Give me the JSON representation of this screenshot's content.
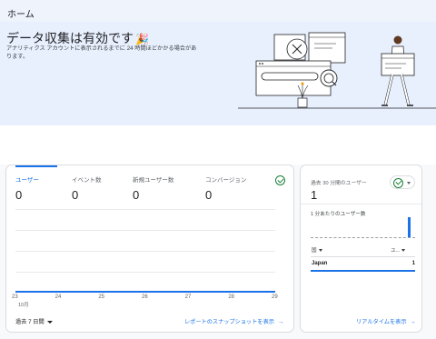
{
  "header": {
    "title": "ホーム"
  },
  "banner": {
    "title": "データ収集は有効です",
    "emoji": "🎉",
    "subtitle": "アナリティクス アカウントに表示されるまでに 24 時間ほどかかる場合があります。"
  },
  "overview": {
    "metrics": [
      {
        "label": "ユーザー",
        "value": "0"
      },
      {
        "label": "イベント数",
        "value": "0"
      },
      {
        "label": "新規ユーザー数",
        "value": "0"
      },
      {
        "label": "コンバージョン",
        "value": "0"
      }
    ],
    "chart_data": {
      "type": "line",
      "x": [
        "23",
        "24",
        "25",
        "26",
        "27",
        "28",
        "29"
      ],
      "x_sublabel": "10月",
      "series": [
        {
          "values": [
            0,
            0,
            0,
            0,
            0,
            0,
            0
          ]
        }
      ],
      "grid": true
    },
    "date_range": "過去 7 日間",
    "snapshot_link": "レポートのスナップショットを表示"
  },
  "realtime": {
    "label": "過去 30 分間のユーザー",
    "value": "1",
    "per_minute_label": "1 分あたりのユーザー数",
    "per_minute_values": [
      0,
      0,
      0,
      0,
      0,
      0,
      0,
      0,
      0,
      0,
      0,
      0,
      0,
      0,
      0,
      0,
      0,
      0,
      0,
      0,
      0,
      0,
      0,
      0,
      0,
      0,
      0,
      0,
      1,
      0
    ],
    "table": {
      "col_country": "国",
      "col_users": "ユ...",
      "rows": [
        {
          "country": "Japan",
          "users": "1"
        }
      ]
    },
    "link": "リアルタイムを表示"
  },
  "colors": {
    "accent": "#1a73e8",
    "success": "#188038",
    "banner_bg": "#e8f0fe"
  }
}
